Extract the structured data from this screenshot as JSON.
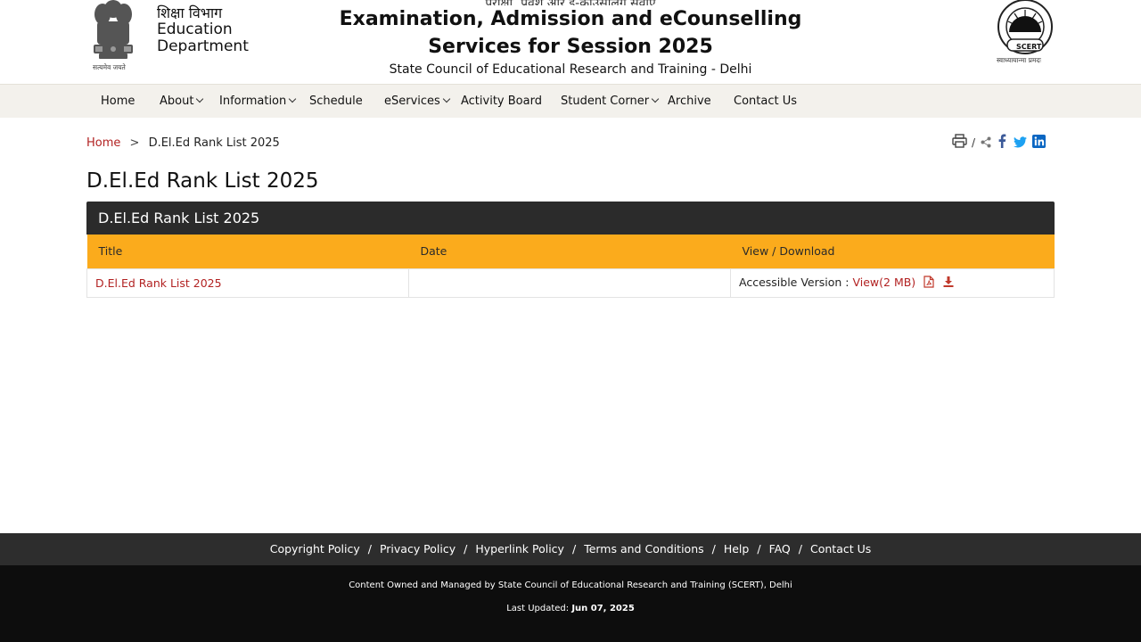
{
  "header": {
    "dept_hindi": "शिक्षा विभाग",
    "dept_line1": "Education",
    "dept_line2": "Department",
    "emblem_motto": "सत्यमेव जयते",
    "top_cut_text": "परीक्षा, प्रवेश और ई-काउंसलिंग सेवाएं",
    "title_line1": "Examination, Admission and eCounselling",
    "title_line2": "Services for Session 2025",
    "subtitle": "State Council of Educational Research and Training - Delhi",
    "logo_text": "SCERT",
    "logo_motto": "स्वाध्यायान्मा प्रमदः"
  },
  "nav": {
    "items": [
      {
        "label": "Home",
        "dropdown": false
      },
      {
        "label": "About",
        "dropdown": true
      },
      {
        "label": "Information",
        "dropdown": true
      },
      {
        "label": "Schedule",
        "dropdown": false
      },
      {
        "label": "eServices",
        "dropdown": true
      },
      {
        "label": "Activity Board",
        "dropdown": false
      },
      {
        "label": "Student Corner",
        "dropdown": true
      },
      {
        "label": "Archive",
        "dropdown": false
      },
      {
        "label": "Contact Us",
        "dropdown": false
      }
    ]
  },
  "breadcrumb": {
    "home": "Home",
    "separator": ">",
    "current": "D.El.Ed Rank List 2025"
  },
  "share": {
    "slash": "/",
    "icons": [
      "print-icon",
      "share-icon",
      "facebook-icon",
      "twitter-icon",
      "linkedin-icon"
    ],
    "colors": {
      "facebook": "#3b5998",
      "twitter": "#1da1f2",
      "linkedin": "#0a66c2"
    }
  },
  "page_title": "D.El.Ed Rank List 2025",
  "panel": {
    "heading": "D.El.Ed Rank List 2025",
    "columns": [
      "Title",
      "Date",
      "View / Download"
    ],
    "rows": [
      {
        "title": "D.El.Ed Rank List 2025",
        "date": "",
        "accessible_label": "Accessible Version :",
        "view_link": "View(2 MB)"
      }
    ]
  },
  "footer": {
    "links": [
      "Copyright Policy",
      "Privacy Policy",
      "Hyperlink Policy",
      "Terms and Conditions",
      "Help",
      "FAQ",
      "Contact Us"
    ],
    "separator": "/",
    "owned": "Content Owned and Managed by State Council of Educational Research and Training (SCERT), Delhi",
    "updated_label": "Last Updated:",
    "updated_date": "Jun 07, 2025"
  },
  "colors": {
    "accent": "#b22222",
    "table_header": "#fbab1c",
    "panel_head": "#2b2b2b",
    "nav_bg": "#f3f1ec",
    "footer_top": "#2d2d2d",
    "footer_bottom": "#0d0d0d"
  }
}
